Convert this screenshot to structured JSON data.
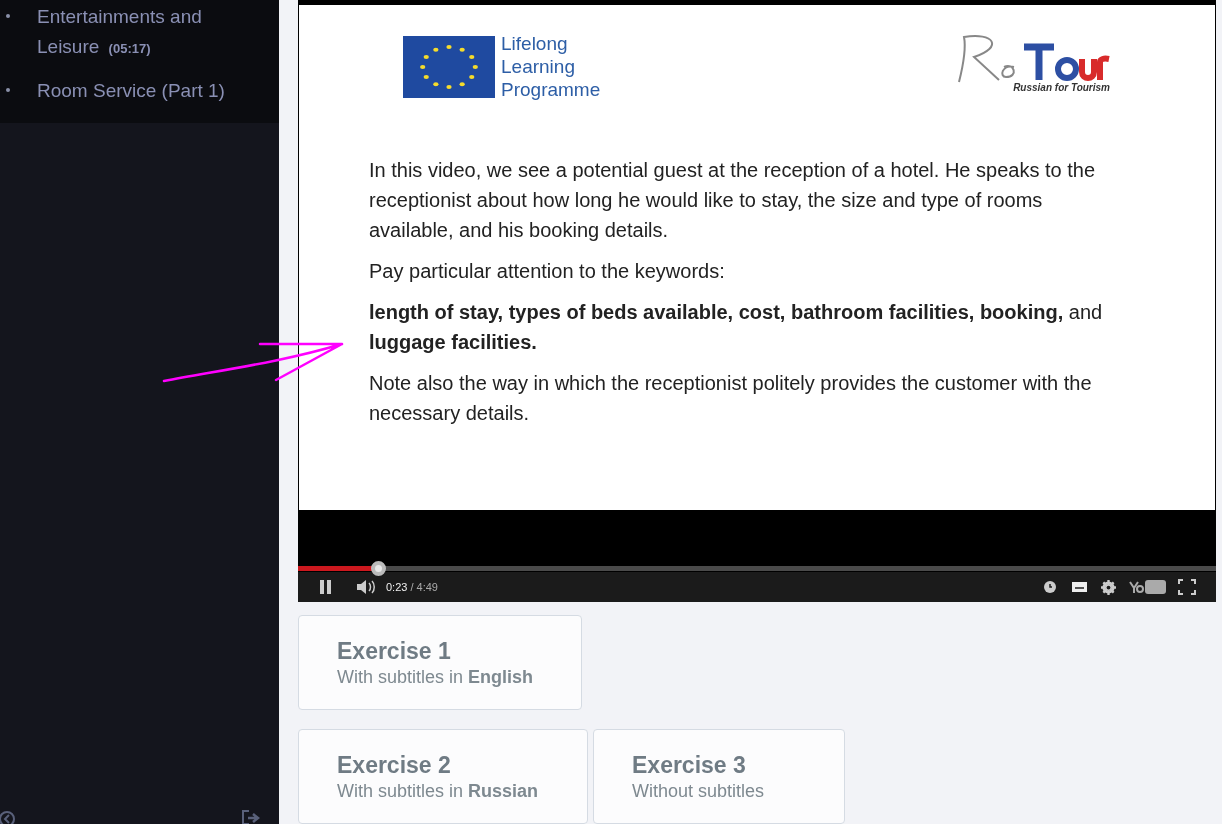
{
  "sidebar": {
    "items": [
      {
        "title": "Entertainments and Leisure",
        "duration": "(05:17)"
      },
      {
        "title": "Room Service (Part 1)"
      }
    ]
  },
  "video": {
    "slide": {
      "eu_logo": "Lifelong Learning Programme",
      "brand_tagline": "Russian for Tourism",
      "paragraphs": [
        "In this video, we see a potential guest at the reception of a hotel. He speaks to the receptionist about how long he would like to stay, the size and type of rooms available, and his booking details.",
        "Pay particular attention to the keywords:",
        "**length of stay, types of beds available, cost, bathroom facilities, booking,** and **luggage facilities.**",
        "Note also the way in which the receptionist politely provides the customer with the necessary details."
      ]
    },
    "playing": true,
    "level": 0.087,
    "current_time": "0:23",
    "total_time": "/ 4:49"
  },
  "exercises": [
    {
      "title": "Exercise 1",
      "subtitle": "With subtitles in **English**"
    },
    {
      "title": "Exercise 2",
      "subtitle": "With subtitles in **Russian**"
    },
    {
      "title": "Exercise 3",
      "subtitle": "Without subtitles"
    }
  ]
}
